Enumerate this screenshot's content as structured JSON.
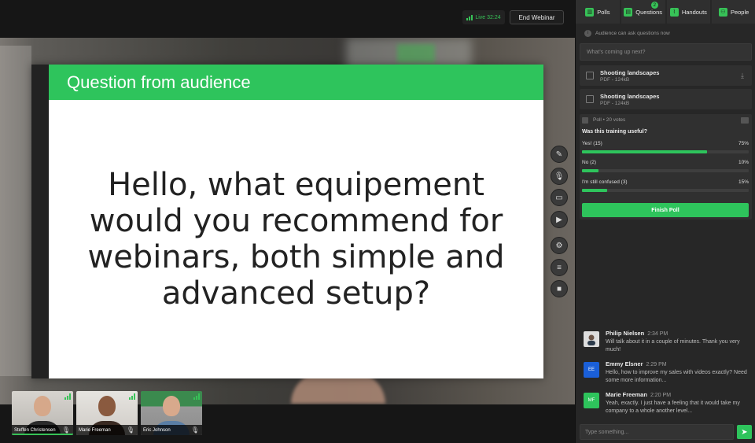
{
  "topbar": {
    "live_label": "Live 32:24",
    "end_button": "End Webinar"
  },
  "slide": {
    "header": "Question from audience",
    "body": "Hello, what equipement would you recommend for webinars, both simple and advanced setup?"
  },
  "tools": [
    {
      "icon": "pencil-icon"
    },
    {
      "icon": "microphone-icon"
    },
    {
      "icon": "screen-share-icon"
    },
    {
      "icon": "play-icon"
    },
    {
      "icon": "camera-settings-icon"
    },
    {
      "icon": "mixer-icon"
    },
    {
      "icon": "video-camera-icon"
    }
  ],
  "participants": [
    {
      "name": "Steffen Christensen",
      "active": true
    },
    {
      "name": "Marie Freeman",
      "active": false
    },
    {
      "name": "Eric Johnson",
      "active": false
    }
  ],
  "sidebar": {
    "tabs": [
      {
        "label": "Polls",
        "icon": "chart-icon"
      },
      {
        "label": "Questions",
        "icon": "chat-bubble-icon",
        "badge": "2"
      },
      {
        "label": "Handouts",
        "icon": "paperclip-icon"
      },
      {
        "label": "People",
        "icon": "people-icon"
      }
    ],
    "notice": "Audience can ask questions now",
    "question_placeholder": "What's coming up next?",
    "handouts": [
      {
        "name": "Shooting landscapes",
        "meta": "PDF - 124kB"
      },
      {
        "name": "Shooting landscapes",
        "meta": "PDF - 124kB"
      }
    ],
    "poll": {
      "header": "Poll • 20 votes",
      "question": "Was this training useful?",
      "options": [
        {
          "label": "Yes! (15)",
          "percent_label": "75%",
          "value": 75
        },
        {
          "label": "No  (2)",
          "percent_label": "10%",
          "value": 10
        },
        {
          "label": "I'm still confused  (3)",
          "percent_label": "15%",
          "value": 15
        }
      ],
      "finish_button": "Finish Poll"
    },
    "chat": [
      {
        "name": "Philip Nielsen",
        "time": "2:34 PM",
        "initials": "",
        "avatar_color": "#ffffff",
        "text": "Will talk about it in a couple of minutes. Thank you very much!"
      },
      {
        "name": "Emmy Elsner",
        "time": "2:29 PM",
        "initials": "EE",
        "avatar_color": "#1a5fd8",
        "text": "Hello, how to improve my sales with videos exactly? Need some more information..."
      },
      {
        "name": "Marie Freeman",
        "time": "2:20 PM",
        "initials": "MF",
        "avatar_color": "#2ec45c",
        "text": "Yeah, exactly. I just have a feeling that it would take my company to a whole another level..."
      }
    ],
    "chat_placeholder": "Type something..."
  },
  "colors": {
    "accent": "#2ec45c",
    "background": "#1b1b1b",
    "panel": "#272727"
  }
}
